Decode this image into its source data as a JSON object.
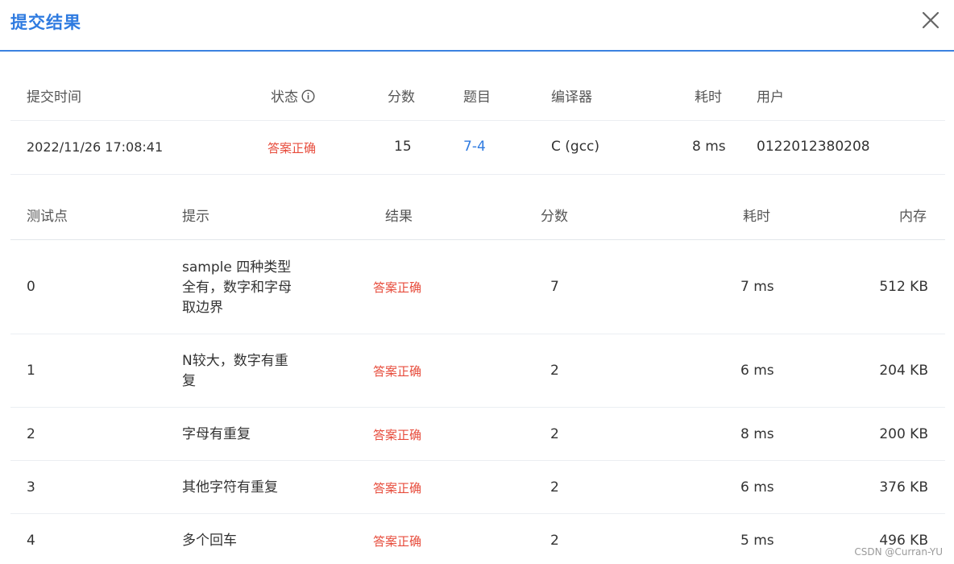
{
  "dialog": {
    "title": "提交结果"
  },
  "submission": {
    "headers": {
      "time": "提交时间",
      "status": "状态",
      "score": "分数",
      "problem": "题目",
      "compiler": "编译器",
      "elapsed": "耗时",
      "user": "用户"
    },
    "row": {
      "time": "2022/11/26 17:08:41",
      "status": "答案正确",
      "score": "15",
      "problem": "7-4",
      "compiler": "C (gcc)",
      "elapsed": "8 ms",
      "user": "0122012380208"
    }
  },
  "testcases": {
    "headers": {
      "point": "测试点",
      "hint": "提示",
      "result": "结果",
      "score": "分数",
      "elapsed": "耗时",
      "memory": "内存"
    },
    "rows": [
      {
        "point": "0",
        "hint": [
          "sample 四种类型",
          "全有，数字和字母",
          "取边界"
        ],
        "result": "答案正确",
        "score": "7",
        "elapsed": "7 ms",
        "memory": "512 KB"
      },
      {
        "point": "1",
        "hint": [
          "N较大，数字有重",
          "复"
        ],
        "result": "答案正确",
        "score": "2",
        "elapsed": "6 ms",
        "memory": "204 KB"
      },
      {
        "point": "2",
        "hint": [
          "字母有重复"
        ],
        "result": "答案正确",
        "score": "2",
        "elapsed": "8 ms",
        "memory": "200 KB"
      },
      {
        "point": "3",
        "hint": [
          "其他字符有重复"
        ],
        "result": "答案正确",
        "score": "2",
        "elapsed": "6 ms",
        "memory": "376 KB"
      },
      {
        "point": "4",
        "hint": [
          "多个回车"
        ],
        "result": "答案正确",
        "score": "2",
        "elapsed": "5 ms",
        "memory": "496 KB"
      }
    ]
  },
  "watermark": "CSDN @Curran-YU",
  "colors": {
    "accent": "#2f7be0",
    "success_text": "#e74c3c"
  },
  "icons": {
    "close": "close-icon",
    "status_info": "info-circle-icon"
  }
}
